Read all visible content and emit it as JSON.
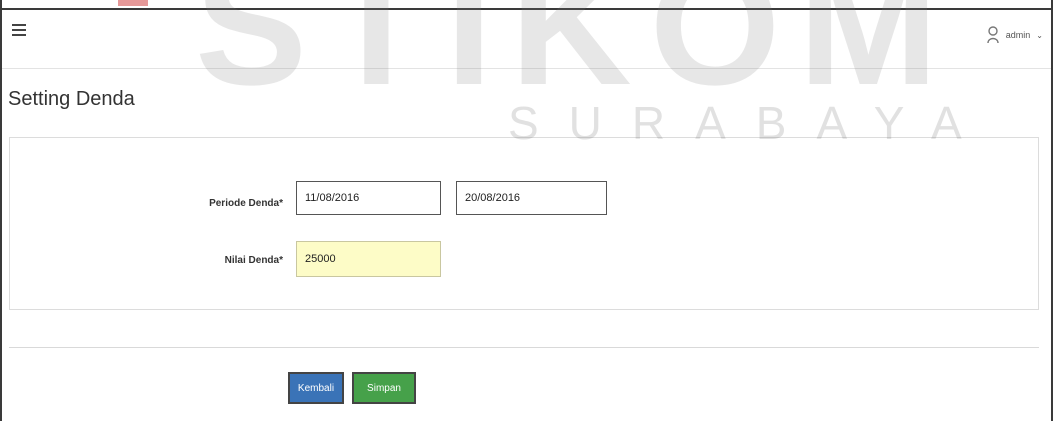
{
  "watermark": {
    "main_text": "STIKOM",
    "sub_text": "SURABAYA"
  },
  "navbar": {
    "menu_icon": "hamburger-icon",
    "user": {
      "icon": "user-icon",
      "name": "admin",
      "caret": "⌄"
    }
  },
  "page": {
    "title": "Setting Denda"
  },
  "form": {
    "periode_label": "Periode Denda*",
    "periode_start": "11/08/2016",
    "periode_end": "20/08/2016",
    "nilai_label": "Nilai Denda*",
    "nilai_value": "25000"
  },
  "actions": {
    "back_label": "Kembali",
    "save_label": "Simpan"
  },
  "colors": {
    "primary": "#3a73b7",
    "success": "#46a14a",
    "highlight_input": "#fdfcc7"
  }
}
